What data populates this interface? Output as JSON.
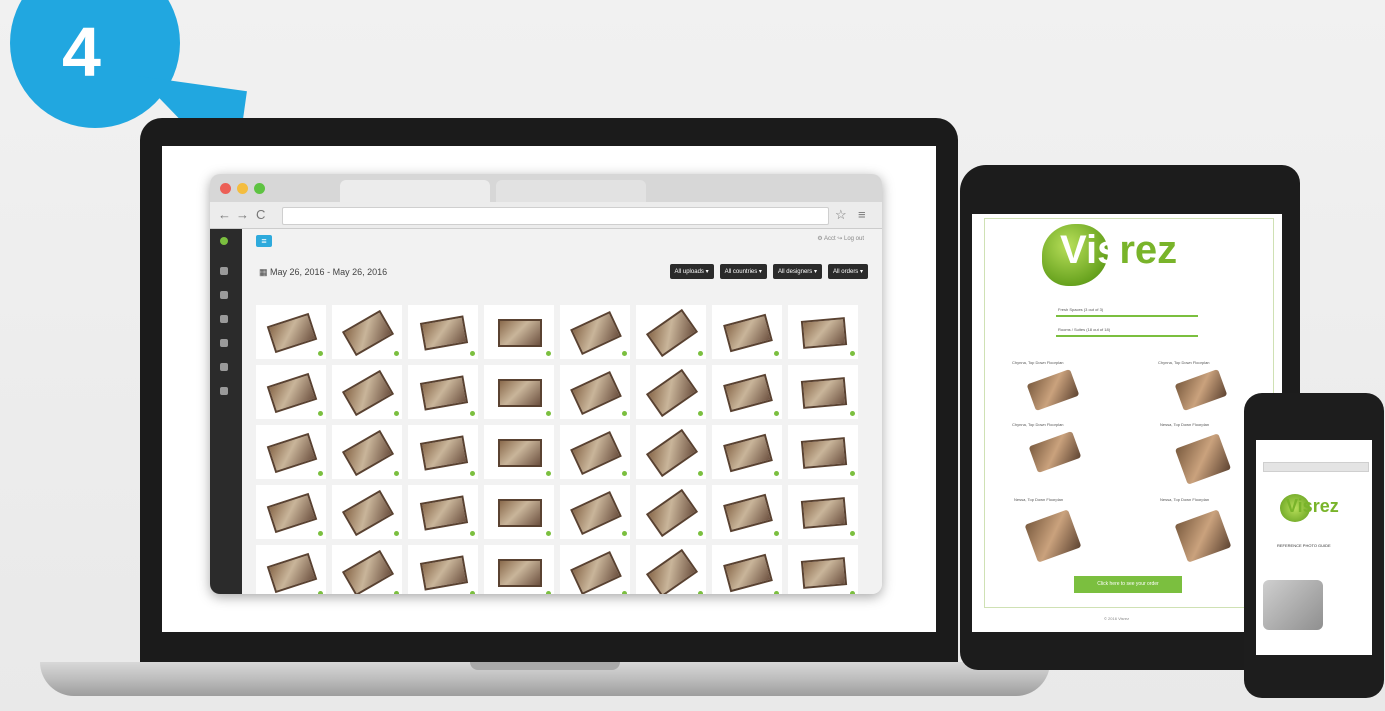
{
  "badge": {
    "number": "4"
  },
  "browser": {
    "nav": {
      "back": "←",
      "forward": "→",
      "reload": "C",
      "star": "☆",
      "menu": "≡"
    },
    "toplinks": "⚙ Acct  ↪ Log out",
    "date_range": "May 26, 2016 - May 26, 2016",
    "filters": [
      "All uploads ▾",
      "All countries ▾",
      "All designers ▾",
      "All orders ▾"
    ],
    "thumb_rows": 5,
    "thumb_cols": 8
  },
  "tablet": {
    "logo": {
      "part1": "Vis",
      "part2": "rez"
    },
    "progress": [
      {
        "label": "Fresh Spaces (3 out of 3)"
      },
      {
        "label": "Rooms / Suites (18 out of 18)"
      }
    ],
    "captions": [
      "Chynna, Top Down Floorplan",
      "Chynna, Top Down Floorplan",
      "Chynna, Top Down Floorplan",
      "Nessa, Top Down Floorplan",
      "Nessa, Top Down Floorplan",
      "Nessa, Top Down Floorplan"
    ],
    "button": "Click here to see your order",
    "footer": "© 2016 Visrez"
  },
  "phone": {
    "logo": "Visrez",
    "guide": "REFERENCE PHOTO GUIDE"
  }
}
